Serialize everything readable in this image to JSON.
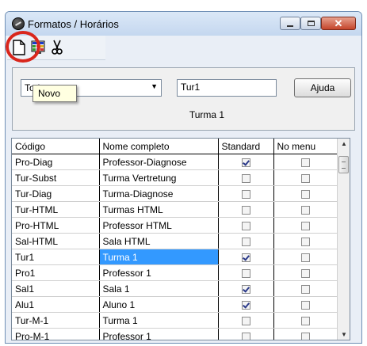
{
  "window": {
    "title": "Formatos / Horários"
  },
  "caption": {
    "close_glyph": "✕"
  },
  "toolbar": {
    "new_tooltip": "Novo"
  },
  "filter": {
    "selected": "Todos"
  },
  "code_input": {
    "value": "Tur1"
  },
  "help_button": {
    "label": "Ajuda"
  },
  "full_name_display": "Turma 1",
  "table": {
    "headers": [
      "Código",
      "Nome completo",
      "Standard",
      "No menu"
    ],
    "rows": [
      {
        "code": "Pro-Diag",
        "name": "Professor-Diagnose",
        "standard": true,
        "no_menu": false
      },
      {
        "code": "Tur-Subst",
        "name": "Turma Vertretung",
        "standard": false,
        "no_menu": false
      },
      {
        "code": "Tur-Diag",
        "name": "Turma-Diagnose",
        "standard": false,
        "no_menu": false
      },
      {
        "code": "Tur-HTML",
        "name": "Turmas HTML",
        "standard": false,
        "no_menu": false
      },
      {
        "code": "Pro-HTML",
        "name": "Professor HTML",
        "standard": false,
        "no_menu": false
      },
      {
        "code": "Sal-HTML",
        "name": "Sala HTML",
        "standard": false,
        "no_menu": false
      },
      {
        "code": "Tur1",
        "name": "Turma 1",
        "standard": true,
        "no_menu": false,
        "selected": true
      },
      {
        "code": "Pro1",
        "name": "Professor 1",
        "standard": false,
        "no_menu": false
      },
      {
        "code": "Sal1",
        "name": "Sala 1",
        "standard": true,
        "no_menu": false
      },
      {
        "code": "Alu1",
        "name": "Aluno 1",
        "standard": true,
        "no_menu": false
      },
      {
        "code": "Tur-M-1",
        "name": "Turma 1",
        "standard": false,
        "no_menu": false
      },
      {
        "code": "Pro-M-1",
        "name": "Professor 1",
        "standard": false,
        "no_menu": false
      }
    ]
  },
  "colors": {
    "selection": "#3399ff",
    "highlight_ring": "#d9261c",
    "tooltip_bg": "#ffffe1"
  },
  "icons": [
    "app-icon",
    "new-document-icon",
    "table-icon",
    "scissors-icon"
  ]
}
